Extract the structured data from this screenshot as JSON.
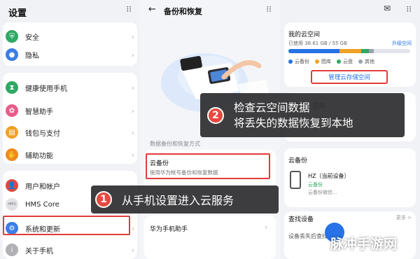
{
  "settings": {
    "title": "设置",
    "items": [
      {
        "label": "安全",
        "color": "#2fa864",
        "icon": "shield-icon",
        "glyph": "⛨"
      },
      {
        "label": "隐私",
        "color": "#3b7de6",
        "icon": "privacy-icon",
        "glyph": "●"
      },
      {
        "label": "健康使用手机",
        "color": "#2fa864",
        "icon": "hourglass-icon",
        "glyph": "⧗"
      },
      {
        "label": "智慧助手",
        "color": "#e95d8a",
        "icon": "assistant-icon",
        "glyph": "✿"
      },
      {
        "label": "钱包与支付",
        "color": "#f0a126",
        "icon": "wallet-icon",
        "glyph": "▤"
      },
      {
        "label": "辅助功能",
        "color": "#f08a1f",
        "icon": "accessibility-icon",
        "glyph": "✋"
      },
      {
        "label": "用户和帐户",
        "color": "#e0483d",
        "icon": "user-icon",
        "glyph": "👤"
      },
      {
        "label": "HMS Core",
        "color": "#e2e2e6",
        "icon": "hms-core-icon",
        "glyph": "HMS"
      },
      {
        "label": "系统和更新",
        "color": "#3b7de6",
        "icon": "gear-icon",
        "glyph": "⚙"
      },
      {
        "label": "关于手机",
        "color": "#b0b0b5",
        "icon": "info-icon",
        "glyph": "i"
      }
    ]
  },
  "backup": {
    "title": "备份和恢复",
    "section_label": "数据备份和恢复方式",
    "cloud_title": "云备份",
    "cloud_desc": "使用华为帐号备份和恢复数据",
    "phone_clone": "华为手机助手"
  },
  "cloud": {
    "my_space": "我的云空间",
    "used": "已使用 38.61 GB / 55 GB",
    "upgrade": "升级空间",
    "legend": [
      {
        "label": "云备份",
        "color": "#2672e6"
      },
      {
        "label": "图库",
        "color": "#f0a126"
      },
      {
        "label": "云盘",
        "color": "#2fa864"
      },
      {
        "label": "其他",
        "color": "#9aa3ad"
      }
    ],
    "used_fraction": 0.7,
    "manage": "管理云存储空间",
    "space_partial": "空间",
    "cloud_backup_section": "云备份",
    "device_name": "HZ（当前设备）",
    "device_status1": "云备份",
    "device_status2": "云备份微信...",
    "find_device": "查找设备",
    "more": "更多 >",
    "find_desc": "设备丢失后查找"
  },
  "callouts": {
    "one_num": "1",
    "one_text": "从手机设置进入云服务",
    "two_num": "2",
    "two_line1": "检查云空间数据",
    "two_line2": "将丢失的数据恢复到本地"
  },
  "watermark": "脉冲手游网"
}
